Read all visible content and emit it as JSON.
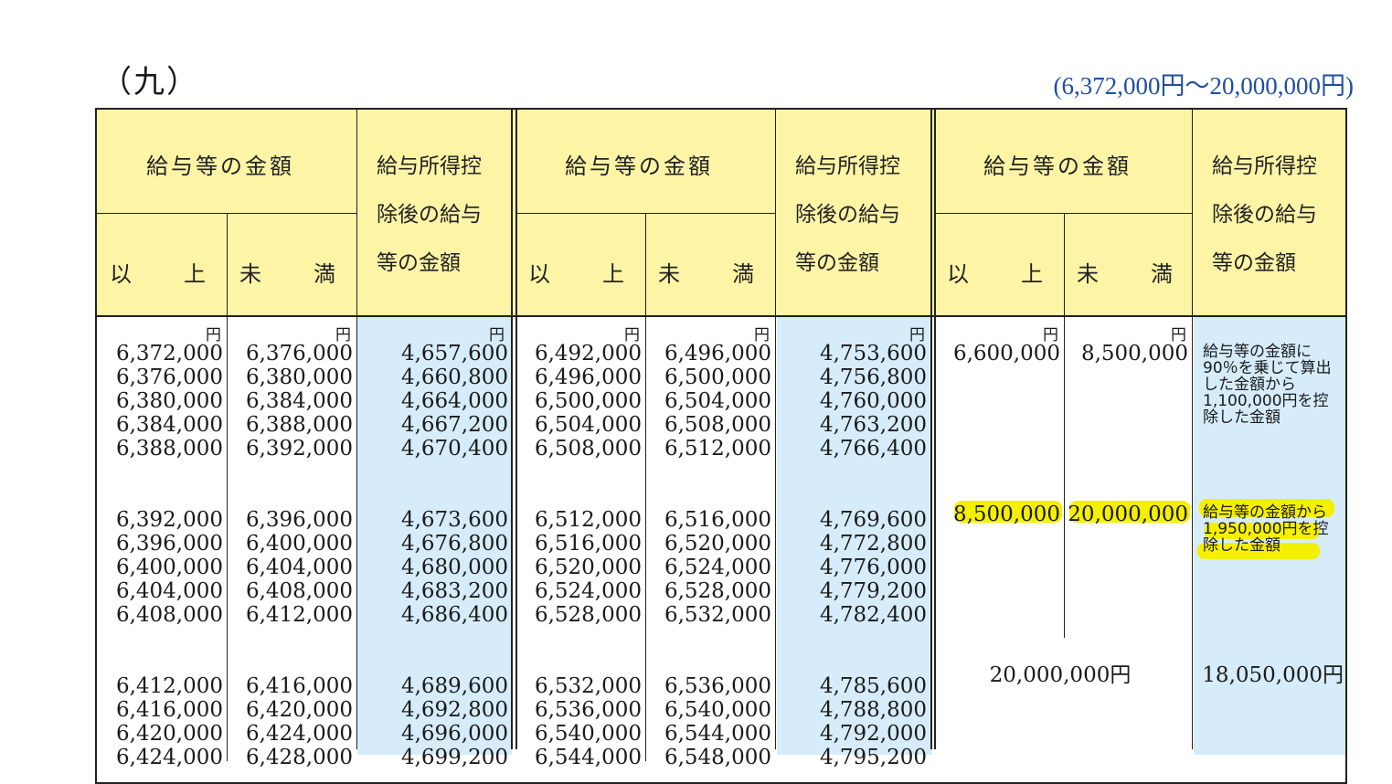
{
  "section_title": "（九）",
  "range_note": "(6,372,000円～20,000,000円)",
  "headers": {
    "salary_amount": "給与等の金額",
    "min": "以　　上",
    "max": "未　　満",
    "after_deduction_line1": "給与所得控",
    "after_deduction_line2": "除後の給与",
    "after_deduction_line3": "等の金額"
  },
  "unit": "円",
  "groups": [
    {
      "min": [
        "6,372,000",
        "6,376,000",
        "6,380,000",
        "6,384,000",
        "6,388,000",
        "",
        "",
        "6,392,000",
        "6,396,000",
        "6,400,000",
        "6,404,000",
        "6,408,000",
        "",
        "",
        "6,412,000",
        "6,416,000",
        "6,420,000",
        "6,424,000"
      ],
      "max": [
        "6,376,000",
        "6,380,000",
        "6,384,000",
        "6,388,000",
        "6,392,000",
        "",
        "",
        "6,396,000",
        "6,400,000",
        "6,404,000",
        "6,408,000",
        "6,412,000",
        "",
        "",
        "6,416,000",
        "6,420,000",
        "6,424,000",
        "6,428,000"
      ],
      "result": [
        "4,657,600",
        "4,660,800",
        "4,664,000",
        "4,667,200",
        "4,670,400",
        "",
        "",
        "4,673,600",
        "4,676,800",
        "4,680,000",
        "4,683,200",
        "4,686,400",
        "",
        "",
        "4,689,600",
        "4,692,800",
        "4,696,000",
        "4,699,200"
      ]
    },
    {
      "min": [
        "6,492,000",
        "6,496,000",
        "6,500,000",
        "6,504,000",
        "6,508,000",
        "",
        "",
        "6,512,000",
        "6,516,000",
        "6,520,000",
        "6,524,000",
        "6,528,000",
        "",
        "",
        "6,532,000",
        "6,536,000",
        "6,540,000",
        "6,544,000"
      ],
      "max": [
        "6,496,000",
        "6,500,000",
        "6,504,000",
        "6,508,000",
        "6,512,000",
        "",
        "",
        "6,516,000",
        "6,520,000",
        "6,524,000",
        "6,528,000",
        "6,532,000",
        "",
        "",
        "6,536,000",
        "6,540,000",
        "6,544,000",
        "6,548,000"
      ],
      "result": [
        "4,753,600",
        "4,756,800",
        "4,760,000",
        "4,763,200",
        "4,766,400",
        "",
        "",
        "4,769,600",
        "4,772,800",
        "4,776,000",
        "4,779,200",
        "4,782,400",
        "",
        "",
        "4,785,600",
        "4,788,800",
        "4,792,000",
        "4,795,200"
      ]
    }
  ],
  "right_block": {
    "row1_min": "6,600,000",
    "row1_max": "8,500,000",
    "row1_note": "給与等の金額に90％を乗じて算出した金額から1,100,000円を控除した金額",
    "row2_min": "8,500,000",
    "row2_max": "20,000,000",
    "row2_note": "給与等の金額から1,950,000円を控除した金額",
    "row3_amount": "20,000,000円",
    "row3_result": "18,050,000円"
  },
  "colors": {
    "header_bg": "#fdf4a6",
    "result_bg": "#d6ecfa",
    "highlight": "#f5f000",
    "range_note": "#1f4fa0"
  }
}
